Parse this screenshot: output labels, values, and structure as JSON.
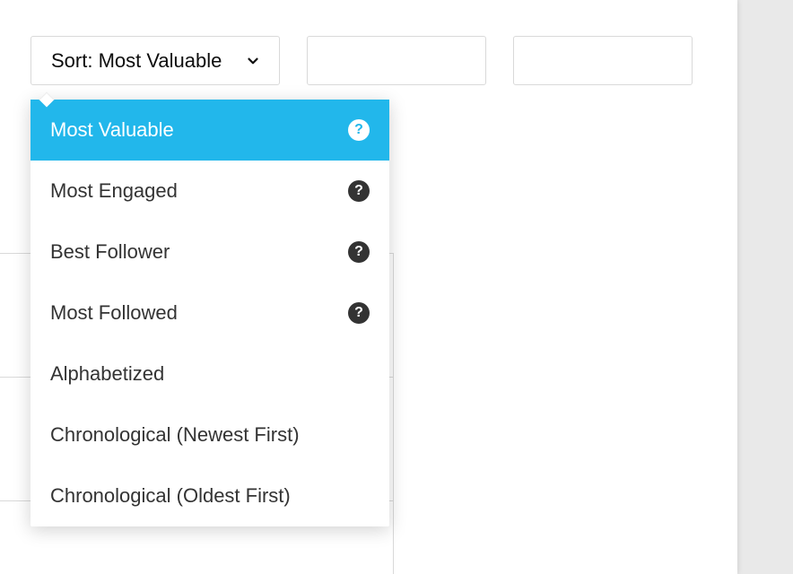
{
  "toolbar": {
    "sort_label": "Sort: Most Valuable"
  },
  "dropdown": {
    "items": [
      {
        "label": "Most Valuable",
        "has_help": true,
        "active": true
      },
      {
        "label": "Most Engaged",
        "has_help": true,
        "active": false
      },
      {
        "label": "Best Follower",
        "has_help": true,
        "active": false
      },
      {
        "label": "Most Followed",
        "has_help": true,
        "active": false
      },
      {
        "label": "Alphabetized",
        "has_help": false,
        "active": false
      },
      {
        "label": "Chronological (Newest First)",
        "has_help": false,
        "active": false
      },
      {
        "label": "Chronological (Oldest First)",
        "has_help": false,
        "active": false
      }
    ]
  },
  "icons": {
    "help_glyph": "?"
  }
}
